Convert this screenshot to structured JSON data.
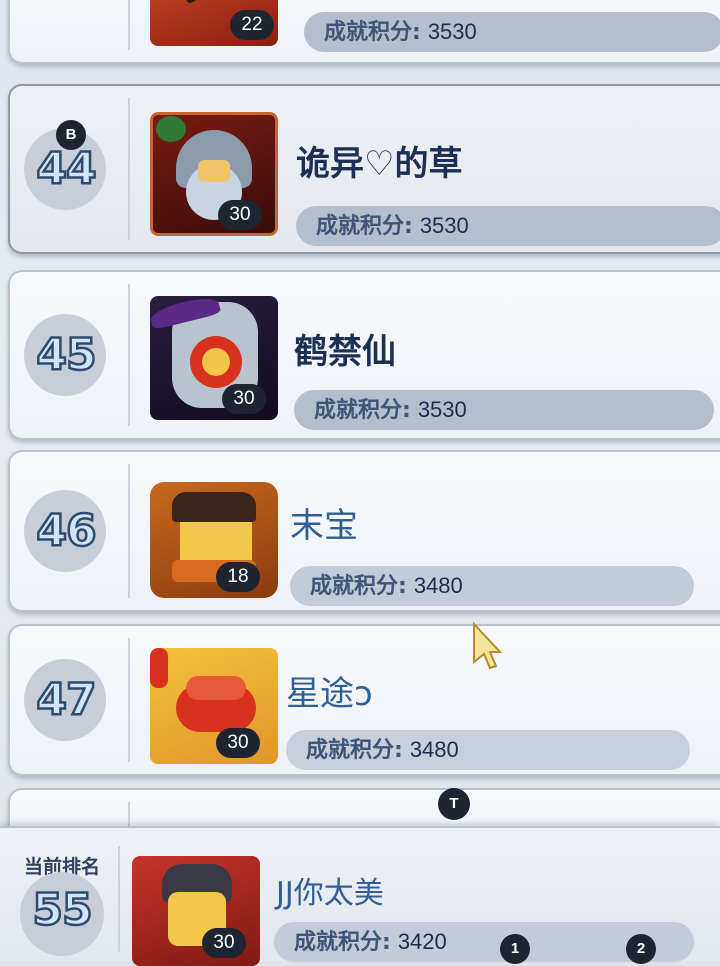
{
  "ranking": [
    {
      "rank": "",
      "name": "",
      "level": "22",
      "score_label": "成就积分:",
      "score": "3530",
      "partial": true
    },
    {
      "rank": "44",
      "badge": "B",
      "name": "诡异♡的草",
      "level": "30",
      "score_label": "成就积分:",
      "score": "3530"
    },
    {
      "rank": "45",
      "name": "鹤禁仙",
      "level": "30",
      "score_label": "成就积分:",
      "score": "3530"
    },
    {
      "rank": "46",
      "name": "末宝",
      "level": "18",
      "score_label": "成就积分:",
      "score": "3480"
    },
    {
      "rank": "47",
      "name": "星途ↄ",
      "level": "30",
      "score_label": "成就积分:",
      "score": "3480"
    }
  ],
  "divider_badge": "T",
  "current_player": {
    "title": "当前排名",
    "rank": "55",
    "name": "JJ你太美",
    "level": "30",
    "score_label": "成就积分:",
    "score": "3420",
    "badges": [
      "1",
      "2"
    ]
  },
  "colors": {
    "rank_fill": "#cfe6f6",
    "rank_stroke": "#2f4a6e",
    "score_bar": "#b4bfcd",
    "pill": "#1f2530"
  }
}
